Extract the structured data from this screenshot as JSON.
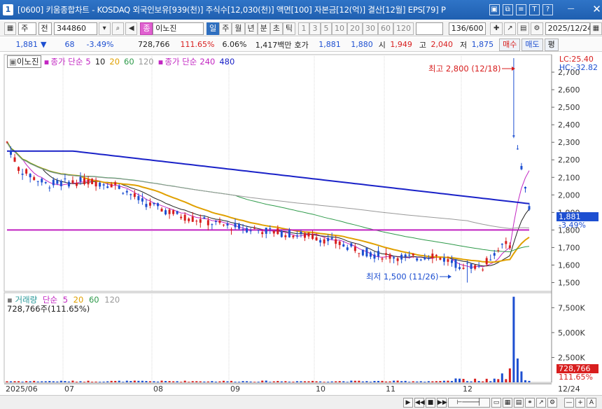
{
  "window": {
    "icon": "1",
    "title": "[0600] 키움종합차트 - KOSDAQ 외국인보유[939(천)] 주식수[12,030(천)] 액면[100] 자본금[12(억)] 결산[12월] EPS[79] P",
    "buttons": [
      "window-list-icon",
      "copy-icon",
      "settings-icon",
      "pin-icon",
      "help-icon",
      "minimize-icon",
      "close-icon"
    ]
  },
  "toolbar": {
    "period_main": "주",
    "period_prev": "전",
    "code": "344860",
    "stock_tag": "종",
    "stock_name": "이노진",
    "periods": [
      "일",
      "주",
      "월",
      "년",
      "분",
      "초",
      "틱"
    ],
    "active_period": "일",
    "intervals": [
      "1",
      "3",
      "5",
      "10",
      "20",
      "30",
      "60",
      "120"
    ],
    "count": "136/600",
    "date": "2025/12/24"
  },
  "quote": {
    "price": "1,881",
    "change": "68",
    "change_pct": "-3.49%",
    "volume": "728,766",
    "volume_pct": "111.65%",
    "turnover_pct": "6.06%",
    "amount": "1,417백만",
    "hoga_label": "호가",
    "ask": "1,881",
    "bid": "1,880",
    "open_label": "시",
    "open": "1,949",
    "high_label": "고",
    "high": "2,040",
    "low_label": "저",
    "low": "1,875",
    "buy_label": "매수",
    "sell_label": "매도",
    "eval_label": "평"
  },
  "legend": {
    "name": "이노진",
    "ma_label": "종가 단순",
    "ma": [
      "5",
      "10",
      "20",
      "60",
      "120"
    ],
    "ma2_label": "종가 단순",
    "ma2": [
      "240",
      "480"
    ],
    "lc": "LC:25.40",
    "hc": "HC:-32.82"
  },
  "volume_legend": {
    "label": "거래량",
    "ma_label": "단순",
    "ma": [
      "5",
      "20",
      "60",
      "120"
    ],
    "value": "728,766주(111.65%)"
  },
  "annotations": {
    "high": "최고 2,800 (12/18)",
    "low": "최저 1,500 (11/26)"
  },
  "axis": {
    "price_ticks": [
      "2,700",
      "2,600",
      "2,500",
      "2,400",
      "2,300",
      "2,200",
      "2,100",
      "2,000",
      "1,900",
      "1,800",
      "1,700",
      "1,600",
      "1,500"
    ],
    "volume_ticks": [
      "7,500K",
      "5,000K",
      "2,500K"
    ],
    "date_ticks": [
      "2025/06",
      "07",
      "08",
      "09",
      "10",
      "11",
      "12",
      "12/24"
    ],
    "last_price_tag": "1,881",
    "last_pct_tag": "-3.49%",
    "last_volume_tag": "728,766",
    "last_volume_pct_tag": "111.65%"
  },
  "colors": {
    "up": "#d81e1e",
    "down": "#1d4fd1",
    "ma5": "#c226c2",
    "ma10": "#222222",
    "ma20": "#e0a000",
    "ma60": "#2e9a4a",
    "ma120": "#999999",
    "ma240": "#c020c0",
    "ma480": "#1a22c8"
  },
  "chart_data": {
    "type": "candlestick",
    "ylim": [
      1450,
      2800
    ],
    "series_overview": [
      {
        "name": "5",
        "approx": "short moving average"
      },
      {
        "name": "480",
        "values_start_end": [
          2250,
          1950
        ]
      },
      {
        "name": "240",
        "values_start_end": [
          1800,
          1800
        ]
      }
    ],
    "high": {
      "date": "12/18",
      "value": 2800
    },
    "low": {
      "date": "11/26",
      "value": 1500
    },
    "last": 1881
  }
}
